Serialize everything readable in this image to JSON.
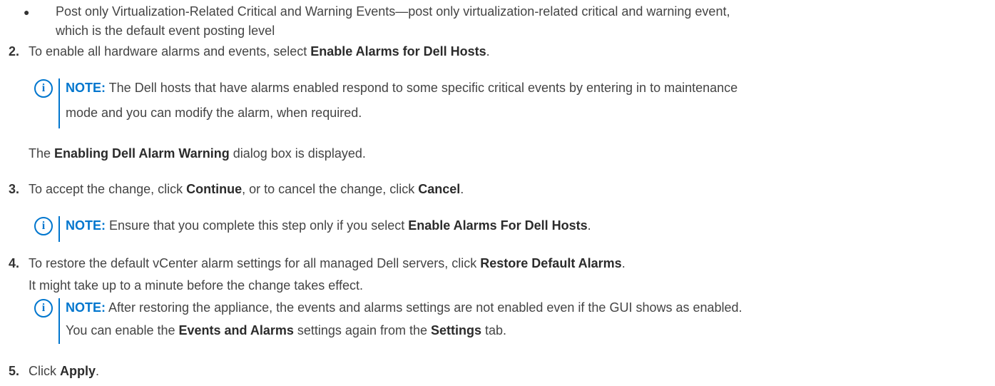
{
  "bullet": {
    "text": "Post only Virtualization-Related Critical and Warning Events—post only virtualization-related critical and warning event,",
    "text_cont": "which is the default event posting level"
  },
  "steps": [
    {
      "num": "2.",
      "pre": "To enable all hardware alarms and events, select ",
      "bold": "Enable Alarms for Dell Hosts",
      "post": ".",
      "note": {
        "label": "NOTE:",
        "line1": " The Dell hosts that have alarms enabled respond to some specific critical events by entering in to maintenance",
        "line2": "mode and you can modify the alarm, when required."
      },
      "after_pre": "The ",
      "after_bold": "Enabling Dell Alarm Warning",
      "after_post": " dialog box is displayed."
    },
    {
      "num": "3.",
      "pre": "To accept the change, click ",
      "bold1": "Continue",
      "mid": ", or to cancel the change, click ",
      "bold2": "Cancel",
      "post": ".",
      "note": {
        "label": "NOTE:",
        "pre": " Ensure that you complete this step only if you select ",
        "bold": "Enable Alarms For Dell Hosts",
        "post": "."
      }
    },
    {
      "num": "4.",
      "pre": "To restore the default vCenter alarm settings for all managed Dell servers, click ",
      "bold": "Restore Default Alarms",
      "post": ".",
      "sub": "It might take up to a minute before the change takes effect.",
      "note": {
        "label": "NOTE:",
        "line1": " After restoring the appliance, the events and alarms settings are not enabled even if the GUI shows as enabled.",
        "l2_pre": "You can enable the ",
        "l2_bold1": "Events and Alarms",
        "l2_mid": " settings again from the ",
        "l2_bold2": "Settings",
        "l2_post": " tab."
      }
    },
    {
      "num": "5.",
      "pre": "Click ",
      "bold": "Apply",
      "post": "."
    }
  ],
  "icons": {
    "note": "info-icon",
    "bullet": "bullet-dot-icon"
  },
  "colors": {
    "accent": "#0076ce",
    "text": "#444444"
  }
}
